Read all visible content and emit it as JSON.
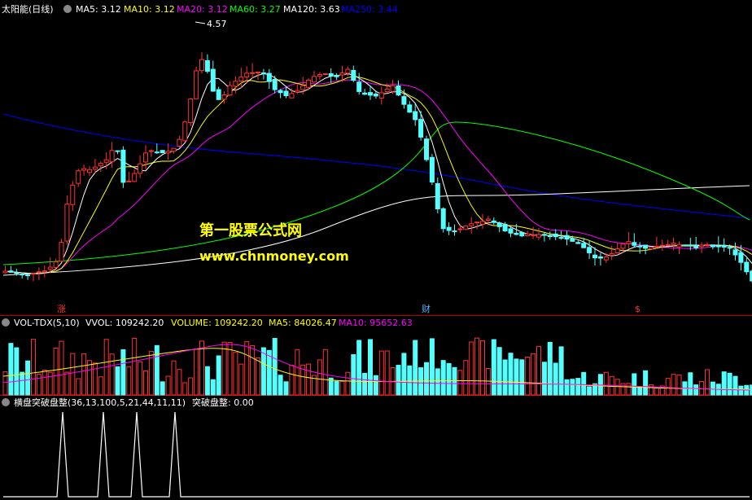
{
  "main_header": {
    "stock_name": "太阳能(日线)",
    "items": [
      {
        "text": "MA5: 3.12",
        "color": "#ffffff"
      },
      {
        "text": "MA10: 3.12",
        "color": "#ffff00"
      },
      {
        "text": "MA20: 3.12",
        "color": "#ff00ff"
      },
      {
        "text": "MA60: 3.27",
        "color": "#00ff00"
      },
      {
        "text": "MA120: 3.63",
        "color": "#ffffff"
      },
      {
        "text": "MA250: 3.44",
        "color": "#0000ff"
      }
    ]
  },
  "high_marker": "4.57",
  "watermark": {
    "line1": "第一股票公式网",
    "line2": "www.chnmoney.com",
    "color": "#ffff00"
  },
  "event_marks": [
    "涨",
    "财",
    "$"
  ],
  "vol_header": {
    "name": "VOL-TDX(5,10)",
    "items": [
      {
        "text": "VVOL: 109242.20",
        "color": "#ffffff"
      },
      {
        "text": "VOLUME: 109242.20",
        "color": "#ffff00"
      },
      {
        "text": "MA5: 84026.47",
        "color": "#ffff00"
      },
      {
        "text": "MA10: 95652.63",
        "color": "#ff00ff"
      }
    ]
  },
  "ind_header": {
    "name": "横盘突破盘整(36,13,100,5,21,44,11,11)",
    "items": [
      {
        "text": "突破盘整: 0.00",
        "color": "#ffffff"
      }
    ]
  },
  "colors": {
    "up": "#ff3232",
    "down": "#54ffff",
    "ma5": "#ffffff",
    "ma10": "#ffff00",
    "ma20": "#ff00ff",
    "ma60": "#00ff00",
    "ma120": "#ffffff",
    "ma250": "#0000ff",
    "divider": "#b40000"
  },
  "icons": [
    "collapse-circle-icon",
    "collapse-circle-icon",
    "collapse-circle-icon"
  ]
}
